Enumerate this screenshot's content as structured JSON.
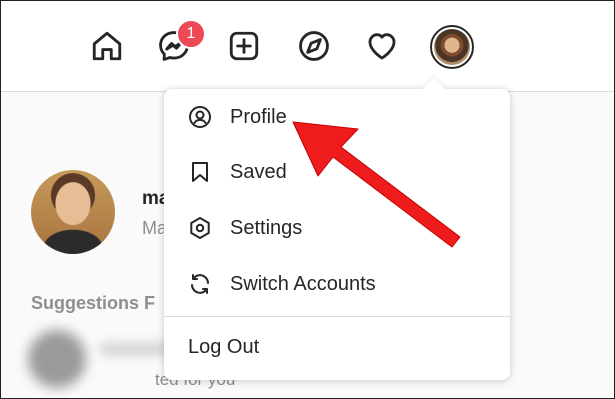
{
  "nav": {
    "icons": [
      "home-icon",
      "messenger-icon",
      "new-post-icon",
      "explore-icon",
      "activity-heart-icon"
    ],
    "badge_count": "1"
  },
  "profile": {
    "username_partial": "ma",
    "fullname_partial": "Ma"
  },
  "suggestions": {
    "heading": "Suggestions F",
    "item_sub": "ted for you"
  },
  "menu": {
    "items": [
      {
        "label": "Profile",
        "icon": "profile-icon"
      },
      {
        "label": "Saved",
        "icon": "bookmark-icon"
      },
      {
        "label": "Settings",
        "icon": "settings-gear-icon"
      },
      {
        "label": "Switch Accounts",
        "icon": "switch-accounts-icon"
      }
    ],
    "logout": "Log Out"
  },
  "colors": {
    "badge": "#ed4956",
    "annotation_arrow": "#ee1c1c",
    "text": "#262626",
    "muted": "#8e8e8e"
  }
}
